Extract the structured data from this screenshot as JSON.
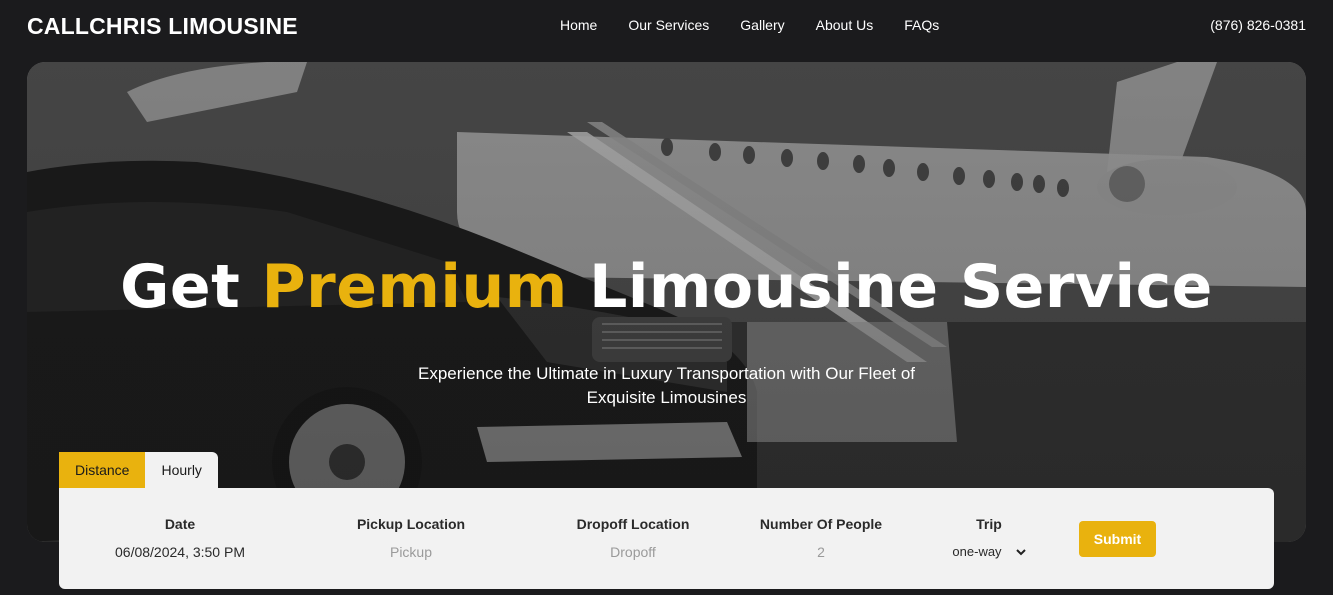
{
  "brand": {
    "name": "CALLCHRIS LIMOUSINE"
  },
  "nav": {
    "items": [
      {
        "label": "Home"
      },
      {
        "label": "Our Services"
      },
      {
        "label": "Gallery"
      },
      {
        "label": "About Us"
      },
      {
        "label": "FAQs"
      }
    ]
  },
  "contact": {
    "phone": "(876) 826-0381"
  },
  "hero": {
    "headline_part1": "Get ",
    "headline_accent": "Premium",
    "headline_part2": " Limousine Service",
    "sub_line1": "Experience the Ultimate in Luxury Transportation with Our Fleet of",
    "sub_line2": "Exquisite Limousines"
  },
  "booking": {
    "tabs": [
      {
        "label": "Distance",
        "active": true
      },
      {
        "label": "Hourly",
        "active": false
      }
    ],
    "fields": {
      "date": {
        "label": "Date",
        "value": "06/08/2024, 3:50 PM"
      },
      "pickup": {
        "label": "Pickup Location",
        "placeholder": "Pickup"
      },
      "dropoff": {
        "label": "Dropoff Location",
        "placeholder": "Dropoff"
      },
      "people": {
        "label": "Number Of People",
        "placeholder": "2"
      },
      "trip": {
        "label": "Trip",
        "value": "one-way"
      }
    },
    "submit_label": "Submit"
  },
  "colors": {
    "accent": "#e9b20e",
    "page_bg": "#1b1b1d",
    "form_bg": "#f2f2f2"
  },
  "icons": {
    "trip_dropdown": "chevron-down-icon"
  }
}
